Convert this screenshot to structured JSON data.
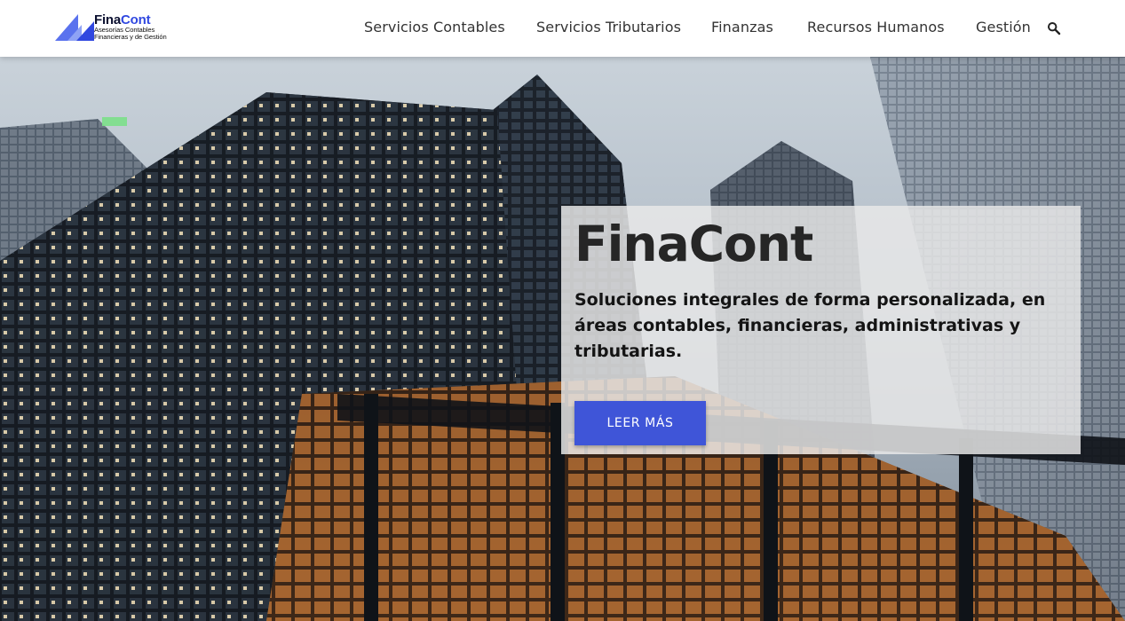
{
  "brand": {
    "name_part1": "Fina",
    "name_part2": "Cont",
    "tagline_line1": "Asesorías Contables",
    "tagline_line2": "Financieras y de Gestión",
    "colors": {
      "dark": "#0b1030",
      "accent": "#3048e0"
    }
  },
  "nav": {
    "items": [
      {
        "label": "Servicios Contables"
      },
      {
        "label": "Servicios Tributarios"
      },
      {
        "label": "Finanzas"
      },
      {
        "label": "Recursos Humanos"
      },
      {
        "label": "Gestión"
      }
    ],
    "search_icon": "search-icon"
  },
  "hero": {
    "title": "FinaCont",
    "subtitle": "Soluciones integrales de forma personalizada, en áreas contables, financieras, administrativas y tributarias.",
    "button_label": "LEER MÁS",
    "button_color": "#3f55d8",
    "background_image": "low-angle view of dark glass skyscrapers against a cloudy sky"
  }
}
